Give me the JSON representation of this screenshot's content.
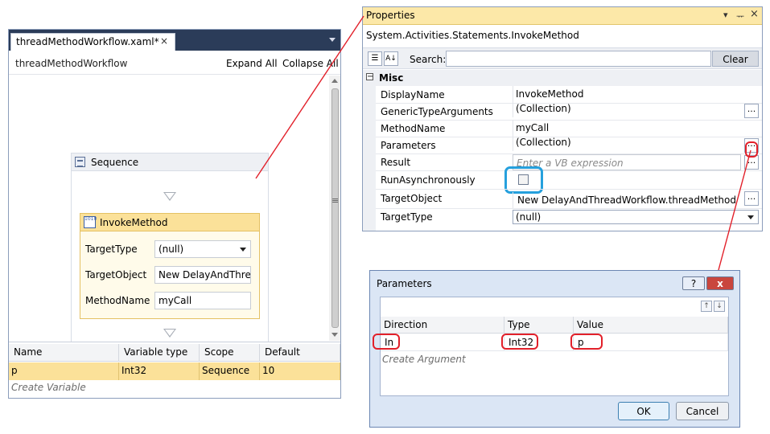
{
  "designer": {
    "tab_title": "threadMethodWorkflow.xaml*",
    "tab_close": "×",
    "breadcrumb": "threadMethodWorkflow",
    "expand_all": "Expand All",
    "collapse_all": "Collapse All",
    "sequence": {
      "title": "Sequence",
      "invoke": {
        "title": "InvokeMethod",
        "icon_text": "1010",
        "target_type_label": "TargetType",
        "target_type_value": "(null)",
        "target_object_label": "TargetObject",
        "target_object_value": "New DelayAndThre",
        "method_name_label": "MethodName",
        "method_name_value": "myCall"
      }
    },
    "scroll_middle_glyph": "≡",
    "variables": {
      "headers": [
        "Name",
        "Variable type",
        "Scope",
        "Default"
      ],
      "row": [
        "p",
        "Int32",
        "Sequence",
        "10"
      ],
      "create_label": "Create Variable"
    }
  },
  "properties": {
    "title": "Properties",
    "pin_glyph": "▾",
    "dock_glyph": "ᅲ",
    "close_glyph": "×",
    "type_name": "System.Activities.Statements.InvokeMethod",
    "search_label": "Search:",
    "search_value": "",
    "clear_label": "Clear",
    "category_toggle": "−",
    "category": "Misc",
    "rows": [
      {
        "name": "DisplayName",
        "value": "InvokeMethod"
      },
      {
        "name": "GenericTypeArguments",
        "value": "(Collection)"
      },
      {
        "name": "MethodName",
        "value": "myCall"
      },
      {
        "name": "Parameters",
        "value": "(Collection)"
      },
      {
        "name": "Result",
        "value": "Enter a VB expression"
      },
      {
        "name": "RunAsynchronously",
        "value": ""
      },
      {
        "name": "TargetObject",
        "value": "New DelayAndThreadWorkflow.threadMethod"
      },
      {
        "name": "TargetType",
        "value": "(null)"
      }
    ],
    "ellipsis": "..."
  },
  "parameters_dialog": {
    "title": "Parameters",
    "help": "?",
    "close": "x",
    "move_up": "↑",
    "move_down": "↓",
    "headers": [
      "Direction",
      "Type",
      "Value"
    ],
    "row": [
      "In",
      "Int32",
      "p"
    ],
    "create_label": "Create Argument",
    "ok": "OK",
    "cancel": "Cancel"
  },
  "colors": {
    "tab_strip": "#2b3c59",
    "properties_title": "#fce8a8",
    "invoke_header": "#fbe199",
    "selected_row": "#fbe199",
    "annotation_red": "#e2202a",
    "annotation_blue": "#25a0dd",
    "dialog_bg": "#dbe6f5"
  }
}
